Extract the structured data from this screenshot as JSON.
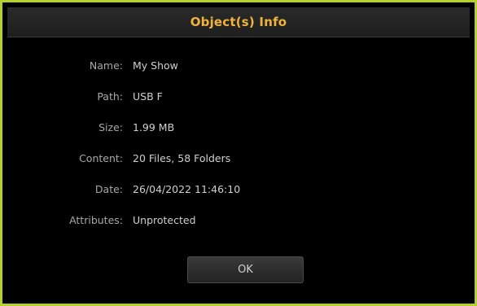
{
  "dialog": {
    "title": "Object(s) Info",
    "rows": [
      {
        "label": "Name:",
        "value": "My Show"
      },
      {
        "label": "Path:",
        "value": "USB F"
      },
      {
        "label": "Size:",
        "value": "1.99 MB"
      },
      {
        "label": "Content:",
        "value": "20 Files, 58 Folders"
      },
      {
        "label": "Date:",
        "value": "26/04/2022 11:46:10"
      },
      {
        "label": "Attributes:",
        "value": "Unprotected"
      }
    ],
    "ok_label": "OK"
  },
  "colors": {
    "border": "#b6d02a",
    "title": "#f2b33d",
    "background": "#000000"
  }
}
